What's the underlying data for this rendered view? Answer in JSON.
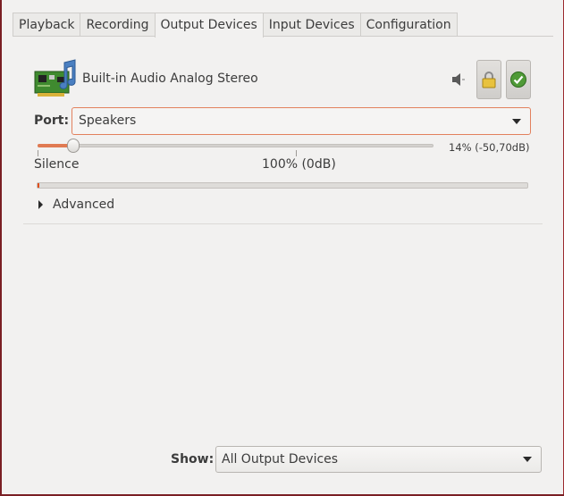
{
  "tabs": [
    {
      "label": "Playback"
    },
    {
      "label": "Recording"
    },
    {
      "label": "Output Devices",
      "active": true
    },
    {
      "label": "Input Devices"
    },
    {
      "label": "Configuration"
    }
  ],
  "device": {
    "name": "Built-in Audio Analog Stereo",
    "icon": "audio-card-icon",
    "port_label": "Port:",
    "port_value": "Speakers",
    "volume": {
      "percent": 14,
      "value_text": "14% (-50,70dB)",
      "mark_silence": "Silence",
      "mark_100": "100% (0dB)"
    },
    "peak_level": 0.003,
    "advanced_label": "Advanced",
    "buttons": {
      "mute_icon": "speaker-muted-icon",
      "lock_icon": "lock-icon",
      "default_icon": "checkmark-icon"
    }
  },
  "footer": {
    "show_label": "Show:",
    "show_value": "All Output Devices"
  },
  "colors": {
    "accent": "#e07a52",
    "meter": "#e0501f",
    "window_border": "#7a1f24"
  }
}
